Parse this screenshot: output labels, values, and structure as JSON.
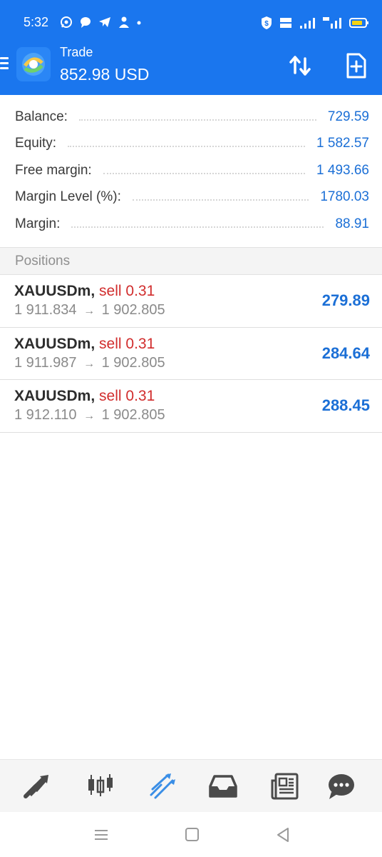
{
  "status_bar": {
    "time": "5:32",
    "left_icons": [
      "whatsapp-icon",
      "chat-bubble-icon",
      "telegram-icon",
      "person-icon",
      "dot-icon"
    ],
    "right_icons": [
      "shield-icon",
      "volte-icon",
      "signal-icon",
      "4g-signal-icon",
      "battery-icon"
    ]
  },
  "app_bar": {
    "title": "Trade",
    "balance": "852.98 USD",
    "icons": [
      "menu-icon",
      "metatrader-logo-icon",
      "sort-icon",
      "new-order-icon"
    ]
  },
  "summary": [
    {
      "label": "Balance:",
      "value": "729.59"
    },
    {
      "label": "Equity:",
      "value": "1 582.57"
    },
    {
      "label": "Free margin:",
      "value": "1 493.66"
    },
    {
      "label": "Margin Level (%):",
      "value": "1780.03"
    },
    {
      "label": "Margin:",
      "value": "88.91"
    }
  ],
  "positions": {
    "header": "Positions",
    "items": [
      {
        "symbol": "XAUUSDm",
        "sep": ",",
        "type": "sell 0.31",
        "open_price": "1 911.834",
        "arrow": "→",
        "current_price": "1 902.805",
        "profit": "279.89"
      },
      {
        "symbol": "XAUUSDm",
        "sep": ",",
        "type": "sell 0.31",
        "open_price": "1 911.987",
        "arrow": "→",
        "current_price": "1 902.805",
        "profit": "284.64"
      },
      {
        "symbol": "XAUUSDm",
        "sep": ",",
        "type": "sell 0.31",
        "open_price": "1 912.110",
        "arrow": "→",
        "current_price": "1 902.805",
        "profit": "288.45"
      }
    ]
  },
  "bottom_nav": {
    "items": [
      "quotes-icon",
      "chart-icon",
      "trade-icon",
      "history-icon",
      "news-icon",
      "messages-icon"
    ],
    "active": "trade-icon",
    "active_color": "#3a8ee6",
    "inactive_color": "#4a4a4a"
  },
  "system_nav": [
    "recents-icon",
    "home-icon",
    "back-icon"
  ],
  "colors": {
    "header_bg": "#1a76ee",
    "value_blue": "#1b6fd6",
    "sell_red": "#d12d2d"
  }
}
